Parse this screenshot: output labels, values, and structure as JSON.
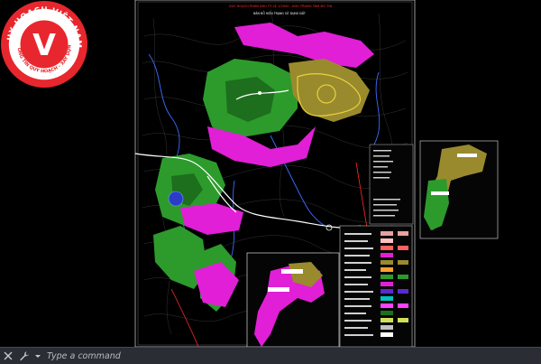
{
  "drawing": {
    "sheet_title": "QUY HOẠCH PHÂN KHU TỶ LỆ 1/2000 - KHU TRUNG TÂM ĐÔ THỊ",
    "map_title": "BẢN ĐỒ HIỆN TRẠNG SỬ DỤNG ĐẤT"
  },
  "watermark": {
    "outer_text_top": "QUY HOẠCH VIỆT NAM",
    "inner_text_bottom": "THÔNG TIN QUY HOẠCH - XÂY DỰNG",
    "letter": "V",
    "color_red": "#e8262d",
    "color_white": "#ffffff"
  },
  "command_line": {
    "placeholder": "Type a command",
    "close_icon": "close-icon",
    "settings_icon": "wrench-icon",
    "history_icon": "chevron-down-icon"
  }
}
